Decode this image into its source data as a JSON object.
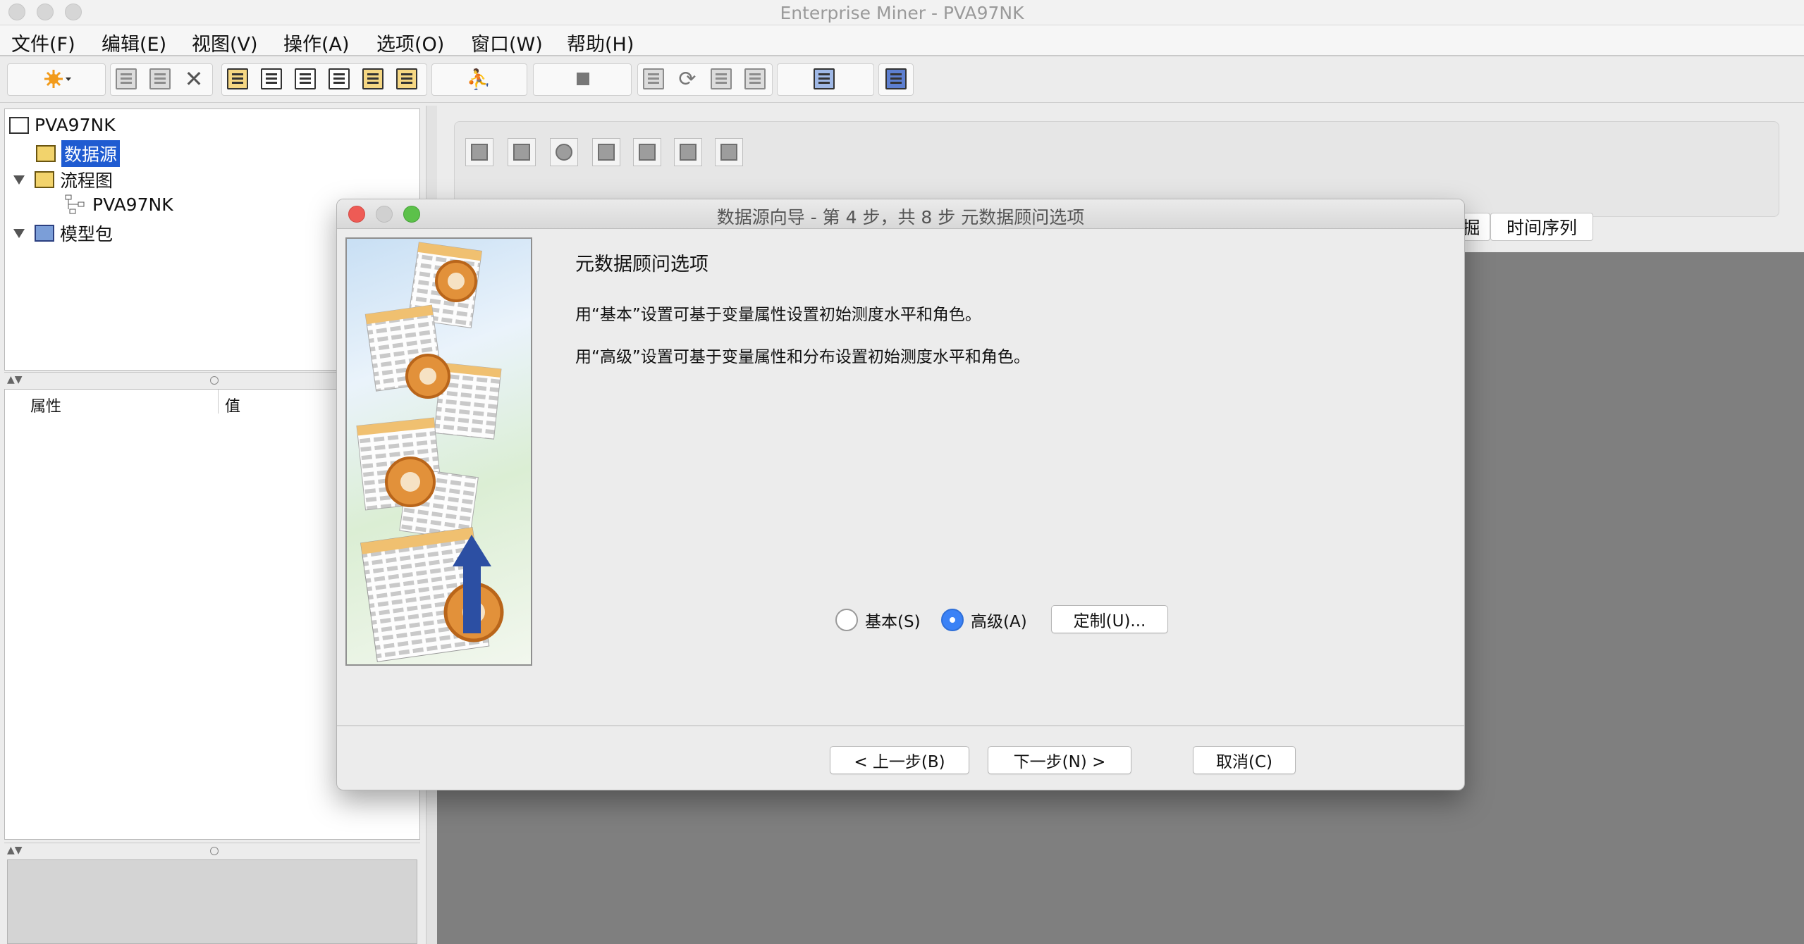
{
  "window": {
    "title": "Enterprise Miner - PVA97NK"
  },
  "menu": [
    "文件(F)",
    "编辑(E)",
    "视图(V)",
    "操作(A)",
    "选项(O)",
    "窗口(W)",
    "帮助(H)"
  ],
  "tree": {
    "root": "PVA97NK",
    "items": [
      {
        "label": "数据源",
        "selected": true
      },
      {
        "label": "流程图"
      },
      {
        "label": "PVA97NK"
      },
      {
        "label": "模型包"
      }
    ]
  },
  "properties": {
    "col_property": "属性",
    "col_value": "值"
  },
  "tabs": {
    "partial": "掘",
    "time_series": "时间序列"
  },
  "dialog": {
    "title": "数据源向导 - 第 4 步，共 8 步 元数据顾问选项",
    "heading": "元数据顾问选项",
    "line1": "用“基本”设置可基于变量属性设置初始测度水平和角色。",
    "line2": "用“高级”设置可基于变量属性和分布设置初始测度水平和角色。",
    "radio_basic": "基本(S)",
    "radio_advanced": "高级(A)",
    "selected_option": "advanced",
    "customize": "定制(U)...",
    "back": "< 上一步(B)",
    "next": "下一步(N) >",
    "cancel": "取消(C)"
  },
  "icons": [
    "new-icon",
    "copy-icon",
    "paste-icon",
    "delete-icon",
    "properties-icon",
    "diagram-icon",
    "explore-icon",
    "notes-icon",
    "search-icon",
    "folder-icon",
    "run-icon",
    "stop-icon",
    "results-icon",
    "refresh-icon",
    "layout-icon",
    "report-icon",
    "open-icon",
    "help-book-icon"
  ]
}
